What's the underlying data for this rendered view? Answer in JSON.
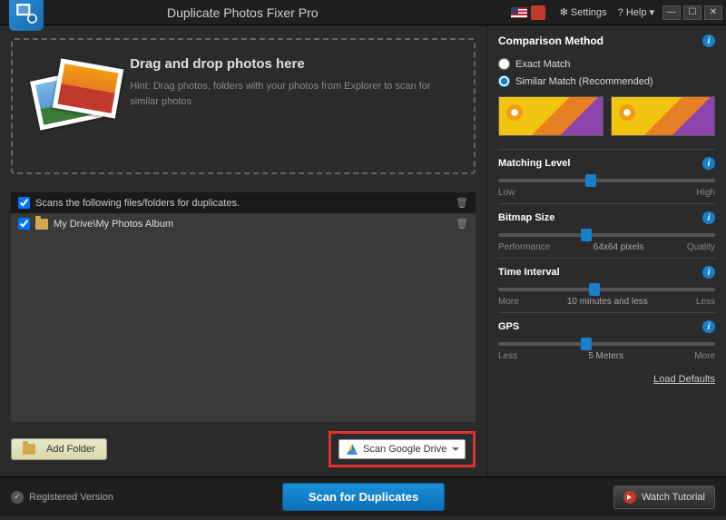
{
  "titlebar": {
    "title": "Duplicate Photos Fixer Pro",
    "settings": "Settings",
    "help": "? Help",
    "badge_count": ""
  },
  "dropzone": {
    "heading": "Drag and drop photos here",
    "hint": "Hint: Drag photos, folders with your photos from Explorer to scan for similar photos"
  },
  "filelist": {
    "header": "Scans the following files/folders for duplicates.",
    "rows": [
      {
        "path": "My Drive\\My Photos Album"
      }
    ]
  },
  "buttons": {
    "add_folder": "Add Folder",
    "scan_drive": "Scan Google Drive",
    "scan_duplicates": "Scan for Duplicates",
    "watch_tutorial": "Watch Tutorial"
  },
  "right": {
    "comparison_title": "Comparison Method",
    "exact": "Exact Match",
    "similar": "Similar Match (Recommended)",
    "matching": {
      "title": "Matching Level",
      "low": "Low",
      "high": "High",
      "pos": 40
    },
    "bitmap": {
      "title": "Bitmap Size",
      "left": "Performance",
      "mid": "64x64 pixels",
      "right": "Quality",
      "pos": 38
    },
    "time": {
      "title": "Time Interval",
      "left": "More",
      "mid": "10 minutes and less",
      "right": "Less",
      "pos": 42
    },
    "gps": {
      "title": "GPS",
      "left": "Less",
      "mid": "5 Meters",
      "right": "More",
      "pos": 38
    },
    "load_defaults": "Load Defaults"
  },
  "footer": {
    "registered": "Registered Version"
  }
}
